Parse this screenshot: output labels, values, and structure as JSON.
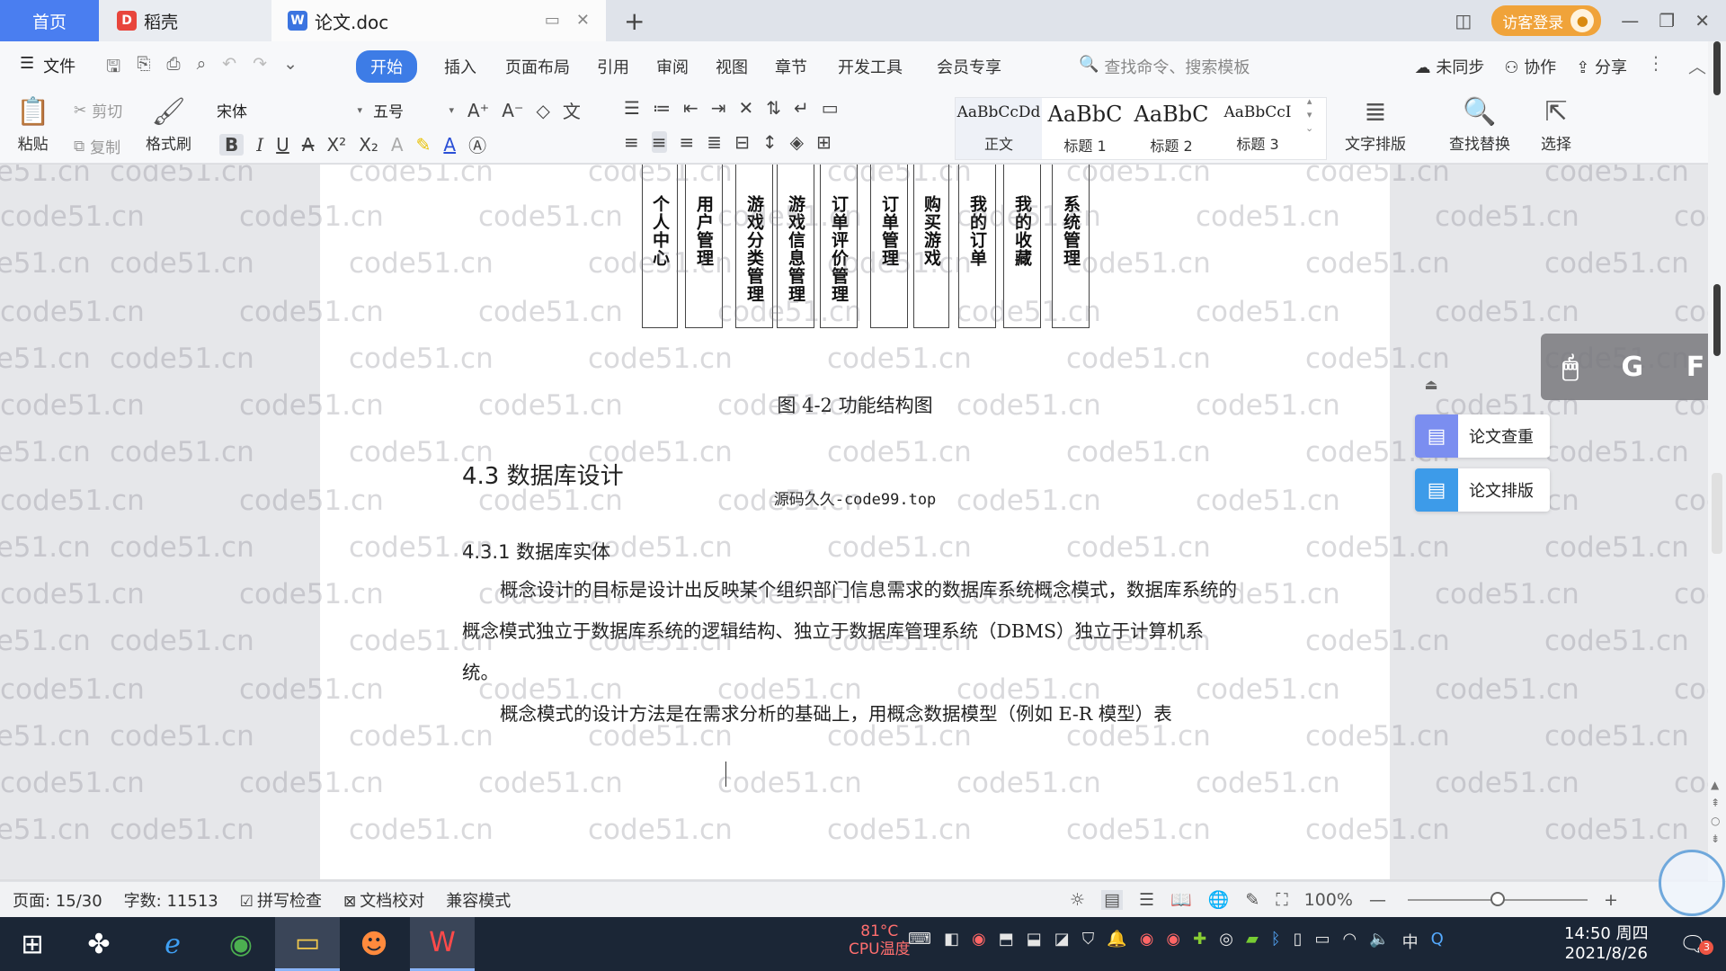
{
  "tabs": {
    "home": "首页",
    "daoke": "稻壳",
    "doc": "论文.doc",
    "new_tab_icon": "plus-icon"
  },
  "titlebar": {
    "login": "访客登录"
  },
  "menu": {
    "file": "文件",
    "items": [
      "开始",
      "插入",
      "页面布局",
      "引用",
      "审阅",
      "视图",
      "章节",
      "开发工具",
      "会员专享"
    ],
    "active_index": 0,
    "search_placeholder": "查找命令、搜索模板",
    "sync": "未同步",
    "collab": "协作",
    "share": "分享"
  },
  "ribbon": {
    "paste": "粘贴",
    "cut": "剪切",
    "copy": "复制",
    "format_painter": "格式刷",
    "font_name": "宋体",
    "font_size": "五号",
    "styles": [
      {
        "sample": "AaBbCcDd",
        "label": "正文"
      },
      {
        "sample": "AaBbC",
        "label": "标题 1"
      },
      {
        "sample": "AaBbC",
        "label": "标题 2"
      },
      {
        "sample": "AaBbCcI",
        "label": "标题 3"
      }
    ],
    "text_layout": "文字排版",
    "find_replace": "查找替换",
    "select": "选择"
  },
  "document": {
    "diagram_boxes": [
      "个人中心",
      "用户管理",
      "游戏分类管理",
      "游戏信息管理",
      "订单评价管理",
      "订单管理",
      "购买游戏",
      "我的订单",
      "我的收藏",
      "系统管理"
    ],
    "figure_caption": "图 4-2 功能结构图",
    "heading_43": "4.3 数据库设计",
    "source_note": "源码久久-code99.top",
    "heading_431": "4.3.1 数据库实体",
    "paragraph1": "概念设计的目标是设计出反映某个组织部门信息需求的数据库系统概念模式，数据库系统的概念模式独立于数据库系统的逻辑结构、独立于数据库管理系统（DBMS）独立于计算机系统。",
    "paragraph2": "概念模式的设计方法是在需求分析的基础上，用概念数据模型（例如 E-R 模型）表",
    "watermark": "code51.cn"
  },
  "side_panel": {
    "check": "论文查重",
    "layout": "论文排版"
  },
  "statusbar": {
    "page": "页面: 15/30",
    "words": "字数: 11513",
    "spell": "拼写检查",
    "proof": "文档校对",
    "compat": "兼容模式",
    "zoom": "100%",
    "zoom_fraction": 0.5
  },
  "taskbar": {
    "temp": "81°C",
    "temp_label": "CPU温度",
    "time": "14:50 周四",
    "date": "2021/8/26",
    "notify_count": "3"
  }
}
